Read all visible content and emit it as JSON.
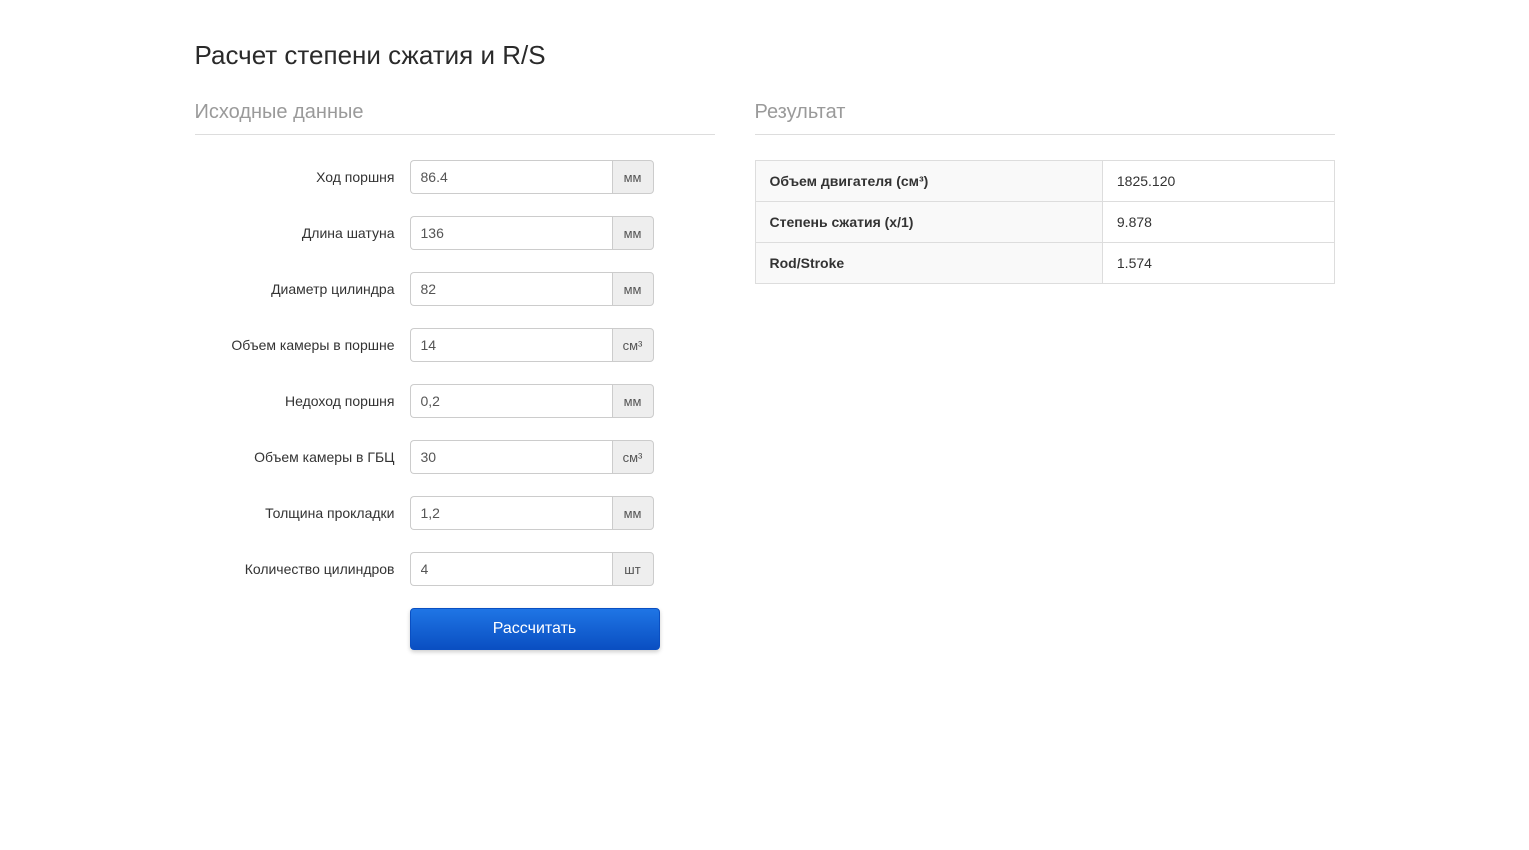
{
  "page": {
    "title": "Расчет степени сжатия и R/S"
  },
  "sections": {
    "input_heading": "Исходные данные",
    "result_heading": "Результат"
  },
  "form": {
    "stroke": {
      "label": "Ход поршня",
      "value": "86.4",
      "unit": "мм"
    },
    "rod_length": {
      "label": "Длина шатуна",
      "value": "136",
      "unit": "мм"
    },
    "bore": {
      "label": "Диаметр цилиндра",
      "value": "82",
      "unit": "мм"
    },
    "piston_chamber": {
      "label": "Объем камеры в поршне",
      "value": "14",
      "unit": "см³"
    },
    "piston_gap": {
      "label": "Недоход поршня",
      "value": "0,2",
      "unit": "мм"
    },
    "head_chamber": {
      "label": "Объем камеры в ГБЦ",
      "value": "30",
      "unit": "см³"
    },
    "gasket": {
      "label": "Толщина прокладки",
      "value": "1,2",
      "unit": "мм"
    },
    "cylinders": {
      "label": "Количество цилиндров",
      "value": "4",
      "unit": "шт"
    },
    "submit_label": "Рассчитать"
  },
  "results": {
    "displacement": {
      "label": "Объем двигателя (см³)",
      "value": "1825.120"
    },
    "compression": {
      "label": "Степень сжатия (x/1)",
      "value": "9.878"
    },
    "rod_stroke": {
      "label": "Rod/Stroke",
      "value": "1.574"
    }
  }
}
